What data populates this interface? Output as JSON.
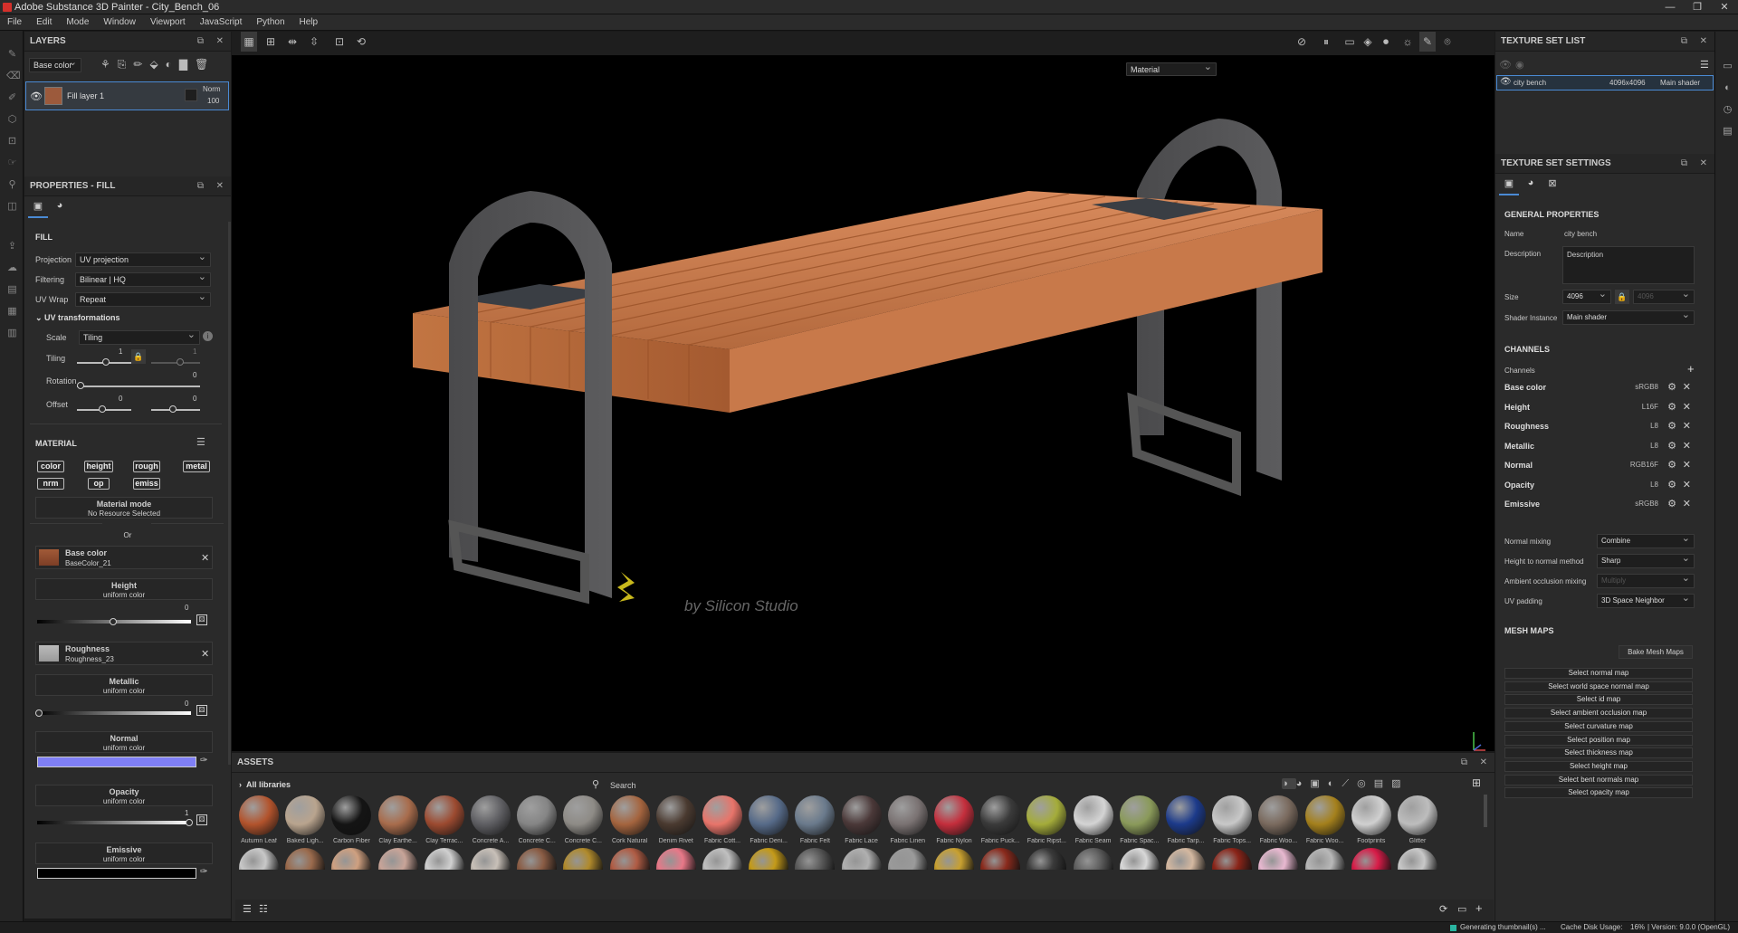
{
  "window": {
    "title": "Adobe Substance 3D Painter - City_Bench_06",
    "controls": [
      "—",
      "❐",
      "✕"
    ]
  },
  "menu": [
    "File",
    "Edit",
    "Mode",
    "Window",
    "Viewport",
    "JavaScript",
    "Python",
    "Help"
  ],
  "layers": {
    "title": "LAYERS",
    "channel": "Base color",
    "layer_name": "Fill layer 1",
    "blend": "Norm",
    "opacity": "100"
  },
  "properties": {
    "title": "PROPERTIES - FILL",
    "fill_section": "FILL",
    "projection_label": "Projection",
    "projection": "UV projection",
    "filtering_label": "Filtering",
    "filtering": "Bilinear | HQ",
    "uvwrap_label": "UV Wrap",
    "uvwrap": "Repeat",
    "uvtrans": "UV transformations",
    "scale_label": "Scale",
    "scale": "Tiling",
    "tiling_label": "Tiling",
    "tiling_value": "1",
    "tiling_value2": "1",
    "rotation_label": "Rotation",
    "rotation_value": "0",
    "offset_label": "Offset",
    "offset_x": "0",
    "offset_y": "0",
    "material_section": "MATERIAL",
    "mat_buttons": [
      "color",
      "height",
      "rough",
      "metal",
      "nrm",
      "op",
      "emiss"
    ],
    "material_mode": "Material mode",
    "no_resource": "No Resource Selected",
    "or": "Or",
    "base_color": "Base color",
    "base_color_res": "BaseColor_21",
    "height": "Height",
    "uniform_color": "uniform color",
    "height_value": "0",
    "roughness": "Roughness",
    "roughness_res": "Roughness_23",
    "metallic": "Metallic",
    "metallic_value": "0",
    "normal": "Normal",
    "opacity": "Opacity",
    "opacity_value": "1",
    "emissive": "Emissive",
    "normal_color": "#7f7ff5",
    "emissive_color": "#000000"
  },
  "viewport": {
    "mode": "Material",
    "watermark": "by Silicon Studio"
  },
  "texture_set_list": {
    "title": "TEXTURE SET LIST",
    "name": "city bench",
    "size": "4096x4096",
    "shader": "Main shader"
  },
  "texture_set_settings": {
    "title": "TEXTURE SET SETTINGS",
    "general": "GENERAL PROPERTIES",
    "name_label": "Name",
    "name": "city bench",
    "desc_label": "Description",
    "desc": "Description",
    "size_label": "Size",
    "size": "4096",
    "size2": "4096",
    "shader_label": "Shader Instance",
    "shader": "Main shader",
    "channels_section": "CHANNELS",
    "channels_label": "Channels",
    "channels": [
      {
        "name": "Base color",
        "format": "sRGB8"
      },
      {
        "name": "Height",
        "format": "L16F"
      },
      {
        "name": "Roughness",
        "format": "L8"
      },
      {
        "name": "Metallic",
        "format": "L8"
      },
      {
        "name": "Normal",
        "format": "RGB16F"
      },
      {
        "name": "Opacity",
        "format": "L8"
      },
      {
        "name": "Emissive",
        "format": "sRGB8"
      }
    ],
    "normal_mixing_label": "Normal mixing",
    "normal_mixing": "Combine",
    "htn_label": "Height to normal method",
    "htn": "Sharp",
    "ao_label": "Ambient occlusion mixing",
    "ao": "Multiply",
    "uvpad_label": "UV padding",
    "uvpad": "3D Space Neighbor",
    "mesh_maps": "MESH MAPS",
    "bake": "Bake Mesh Maps",
    "maps": [
      "Select normal map",
      "Select world space normal map",
      "Select id map",
      "Select ambient occlusion map",
      "Select curvature map",
      "Select position map",
      "Select thickness map",
      "Select height map",
      "Select bent normals map",
      "Select opacity map"
    ]
  },
  "assets": {
    "title": "ASSETS",
    "library": "All libraries",
    "search_placeholder": "Search",
    "row1": [
      {
        "name": "Autumn Leaf",
        "color": "#b2532c"
      },
      {
        "name": "Baked Ligh...",
        "color": "#b9a48e"
      },
      {
        "name": "Carbon Fiber",
        "color": "#141414"
      },
      {
        "name": "Clay Earthe...",
        "color": "#a86c4c"
      },
      {
        "name": "Clay Terrac...",
        "color": "#9c4a30"
      },
      {
        "name": "Concrete A...",
        "color": "#5e5e62"
      },
      {
        "name": "Concrete C...",
        "color": "#858585"
      },
      {
        "name": "Concrete C...",
        "color": "#8e8b86"
      },
      {
        "name": "Cork Natural",
        "color": "#a4643e"
      },
      {
        "name": "Denim Rivet",
        "color": "#4a3a30"
      },
      {
        "name": "Fabric Cott...",
        "color": "#e8746a"
      },
      {
        "name": "Fabric Deni...",
        "color": "#566a88"
      },
      {
        "name": "Fabric Felt",
        "color": "#6a7a8c"
      },
      {
        "name": "Fabric Lace",
        "color": "#4a3838"
      },
      {
        "name": "Fabric Linen",
        "color": "#7a7272"
      },
      {
        "name": "Fabric Nylon",
        "color": "#c42e3c"
      },
      {
        "name": "Fabric Puck...",
        "color": "#3a3a3a"
      },
      {
        "name": "Fabric Ripst...",
        "color": "#a4ac3a"
      },
      {
        "name": "Fabric Seam",
        "color": "#d4d4d4"
      },
      {
        "name": "Fabric Spac...",
        "color": "#8a9a5a"
      },
      {
        "name": "Fabric Tarp...",
        "color": "#1c3a8a"
      },
      {
        "name": "Fabric Tops...",
        "color": "#c8c8c8"
      },
      {
        "name": "Fabric Woo...",
        "color": "#7a6a5e"
      },
      {
        "name": "Fabric Woo...",
        "color": "#a4801c"
      },
      {
        "name": "Footprints",
        "color": "#d0d0d0"
      },
      {
        "name": "Glitter",
        "color": "#bdbdbd"
      }
    ],
    "row2": [
      "#c8c8c8",
      "#9a6a4c",
      "#cfa080",
      "#c8a498",
      "#d0d0d0",
      "#c8c0b8",
      "#8a5c44",
      "#b08a2c",
      "#b05c44",
      "#e87888",
      "#c0c0c0",
      "#c49a18",
      "#5a5a5a",
      "#b0b0b0",
      "#9a9a9a",
      "#c8a030",
      "#8a2a1c",
      "#3a3a3a",
      "#606060",
      "#d8d8d8",
      "#d4b8a0",
      "#8a2418",
      "#e8b8d0",
      "#b8b8b8",
      "#d81c48",
      "#c8c8c8"
    ]
  },
  "status": {
    "generating": "Generating thumbnail(s) ...",
    "cache": "Cache Disk Usage:",
    "cache_val": "16%",
    "version": "| Version: 9.0.0 (OpenGL)"
  }
}
